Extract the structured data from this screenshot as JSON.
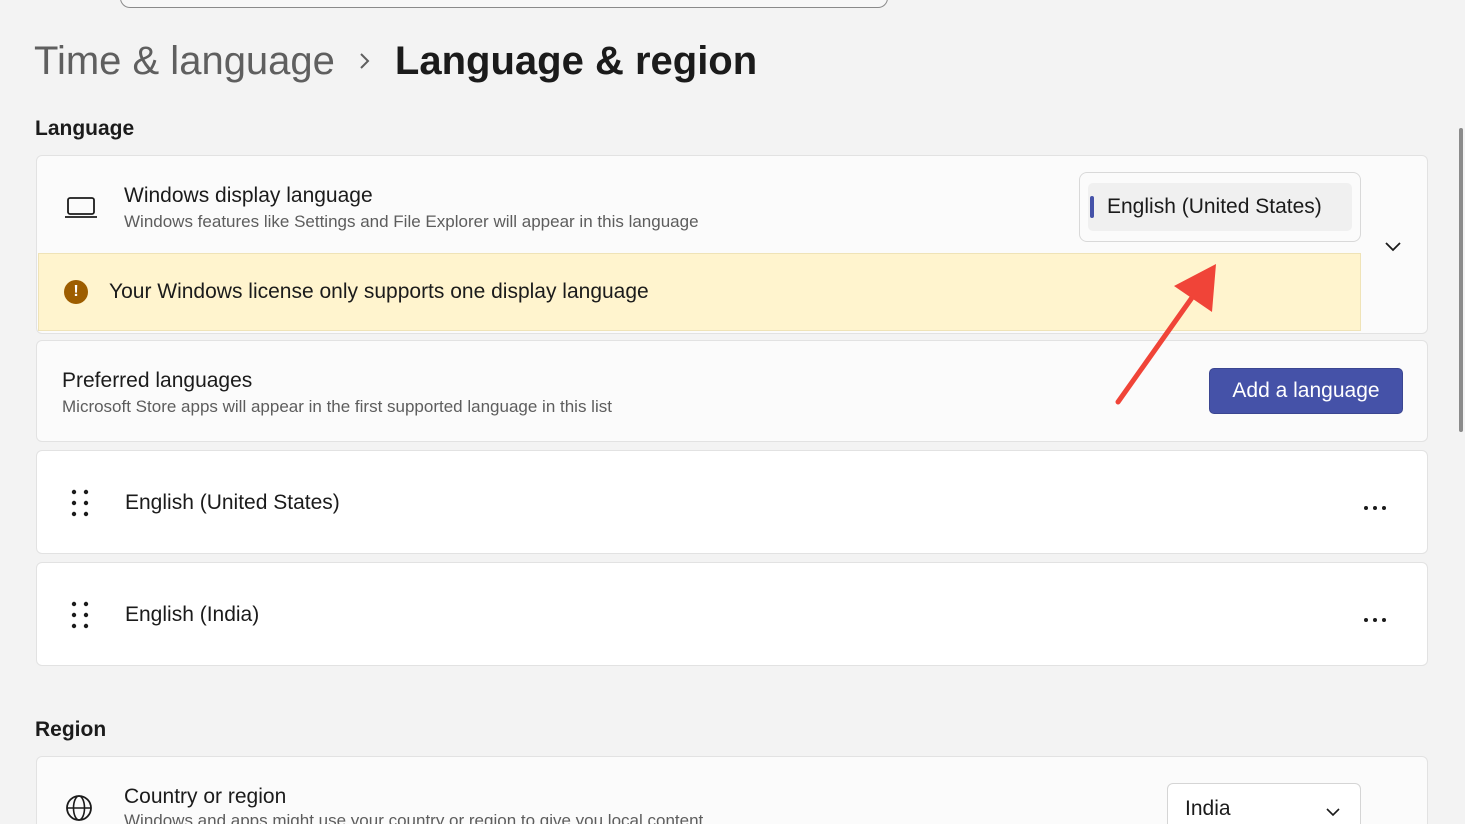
{
  "breadcrumb": {
    "parent": "Time & language",
    "current": "Language & region"
  },
  "language_section": {
    "title": "Language",
    "display_language": {
      "title": "Windows display language",
      "subtitle": "Windows features like Settings and File Explorer will appear in this language",
      "selected": "English (United States)",
      "warning": "Your Windows license only supports one display language"
    },
    "preferred": {
      "title": "Preferred languages",
      "subtitle": "Microsoft Store apps will appear in the first supported language in this list",
      "add_button": "Add a language"
    },
    "languages": [
      {
        "name": "English (United States)"
      },
      {
        "name": "English (India)"
      }
    ]
  },
  "region_section": {
    "title": "Region",
    "country": {
      "title": "Country or region",
      "subtitle": "Windows and apps might use your country or region to give you local content",
      "selected": "India"
    }
  },
  "colors": {
    "accent": "#4552a8",
    "warning_bg": "#fff4ce",
    "warning_icon": "#9d5d00",
    "annotation_arrow": "#f04438"
  }
}
